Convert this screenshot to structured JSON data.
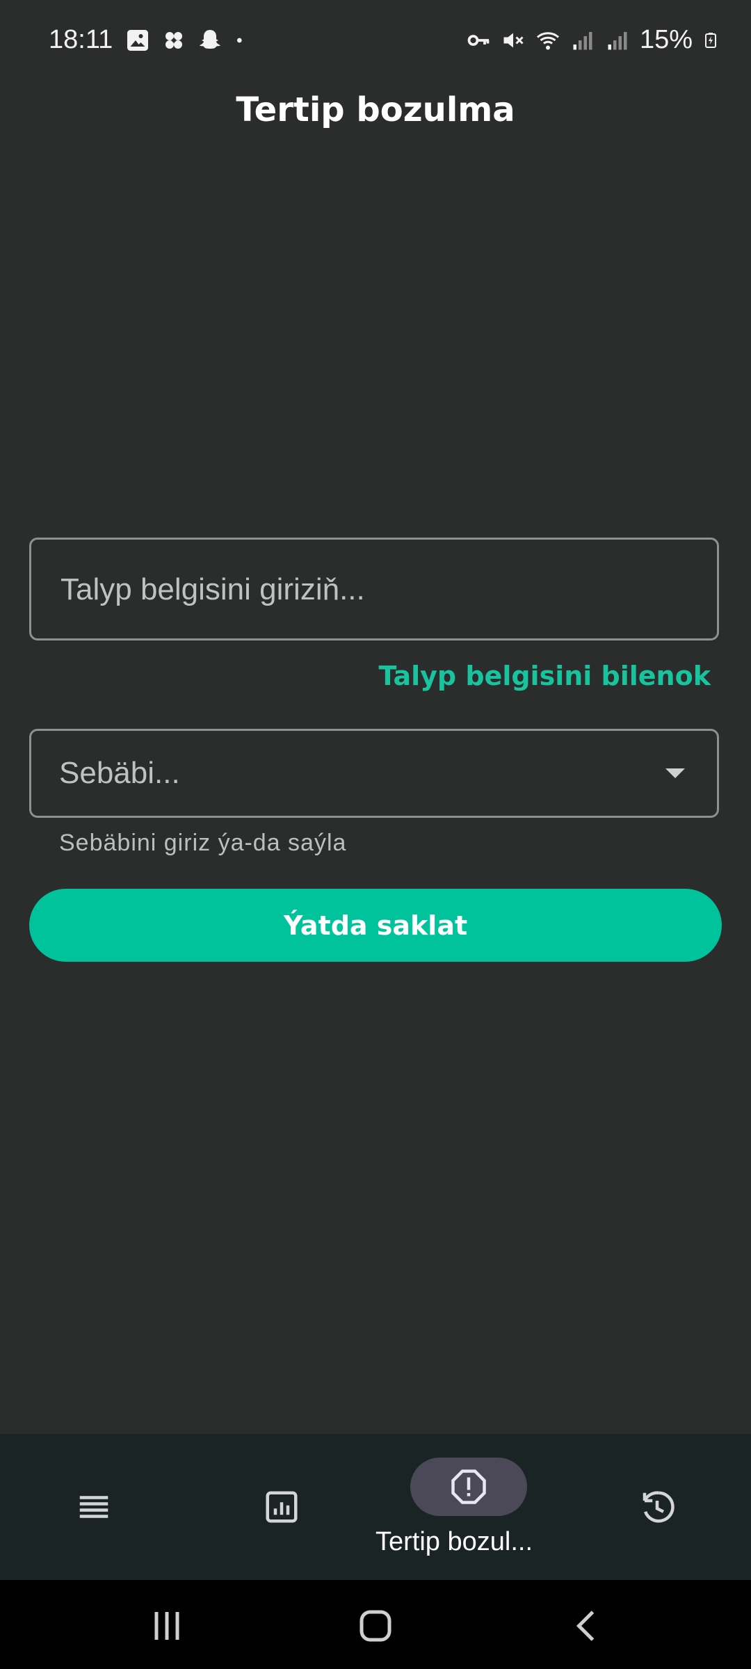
{
  "status_bar": {
    "time": "18:11",
    "battery": "15%",
    "left_icons": [
      "gallery-icon",
      "pinwheel-icon",
      "snapchat-icon",
      "dot-icon"
    ],
    "right_icons": [
      "vpn-key-icon",
      "mute-icon",
      "wifi-icon",
      "signal-icon",
      "signal-icon",
      "battery-charging-icon"
    ]
  },
  "header": {
    "title": "Tertip bozulma"
  },
  "form": {
    "student_id_placeholder": "Talyp belgisini giriziň...",
    "unknown_id_link": "Talyp belgisini bilenok",
    "reason_placeholder": "Sebäbi...",
    "reason_helper": "Sebäbini giriz ýa-da saýla",
    "save_label": "Ýatda saklat"
  },
  "bottom_nav": {
    "items": [
      {
        "icon": "list-icon",
        "label": "",
        "selected": false
      },
      {
        "icon": "stats-icon",
        "label": "",
        "selected": false
      },
      {
        "icon": "alert-octagon-icon",
        "label": "Tertip bozul...",
        "selected": true
      },
      {
        "icon": "history-icon",
        "label": "",
        "selected": false
      }
    ]
  },
  "colors": {
    "background": "#2b2c2c",
    "accent": "#00c39b",
    "nav_background": "#1b2424",
    "nav_pill": "#4b4858"
  }
}
